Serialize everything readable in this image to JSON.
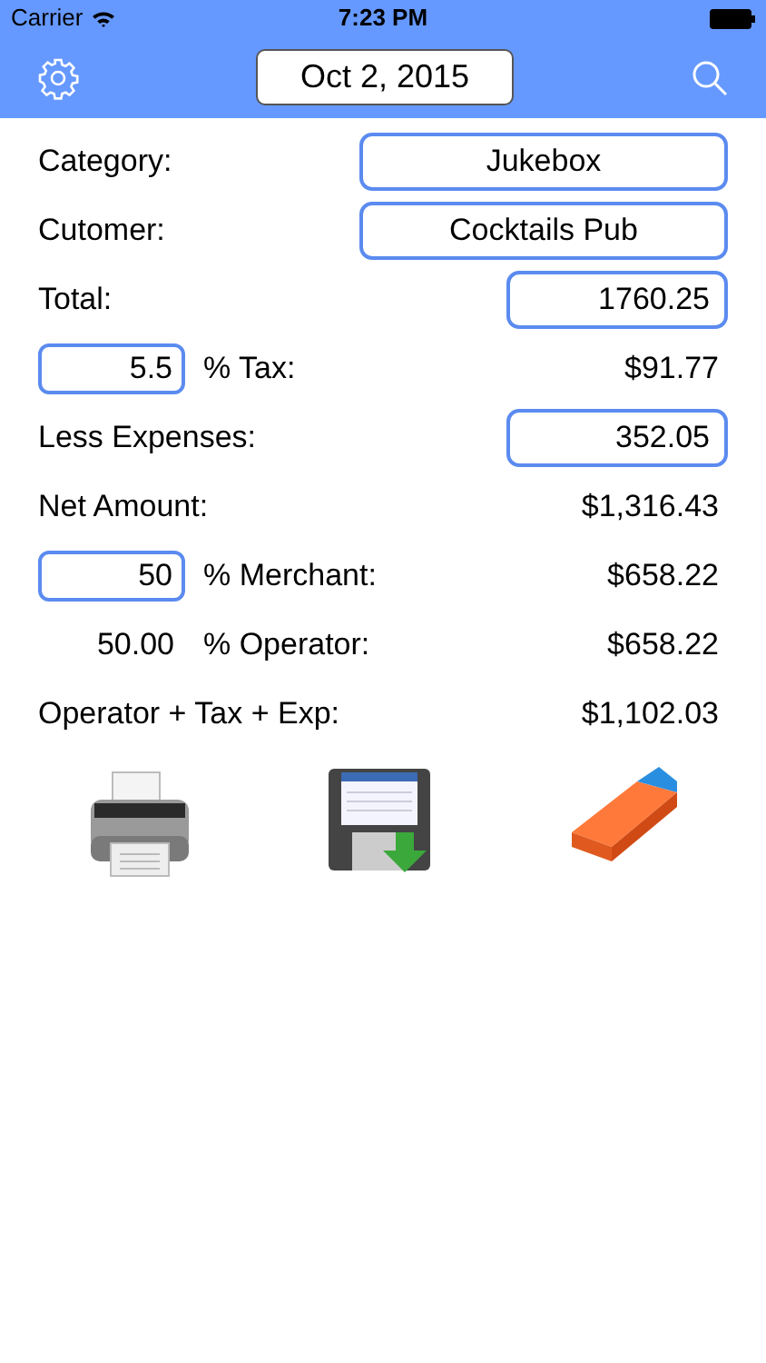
{
  "status_bar": {
    "carrier": "Carrier",
    "time": "7:23 PM"
  },
  "nav": {
    "date": "Oct 2, 2015"
  },
  "rows": [
    {
      "kind": "select",
      "label": "Category:",
      "value": "Jukebox"
    },
    {
      "kind": "select",
      "label": "Cutomer:",
      "value": "Cocktails Pub"
    },
    {
      "kind": "input",
      "label": "Total:",
      "value": "1760.25"
    },
    {
      "kind": "percent",
      "percent": "5.5",
      "label": "% Tax:",
      "amount": "$91.77"
    },
    {
      "kind": "input",
      "label": "Less Expenses:",
      "value": "352.05"
    },
    {
      "kind": "amount",
      "label": "Net Amount:",
      "amount": "$1,316.43"
    },
    {
      "kind": "percent",
      "percent": "50",
      "label": "% Merchant:",
      "amount": "$658.22"
    },
    {
      "kind": "percent_text",
      "percent": "50.00",
      "label": "% Operator:",
      "amount": "$658.22"
    },
    {
      "kind": "amount",
      "label": "Operator + Tax + Exp:",
      "amount": "$1,102.03"
    }
  ]
}
